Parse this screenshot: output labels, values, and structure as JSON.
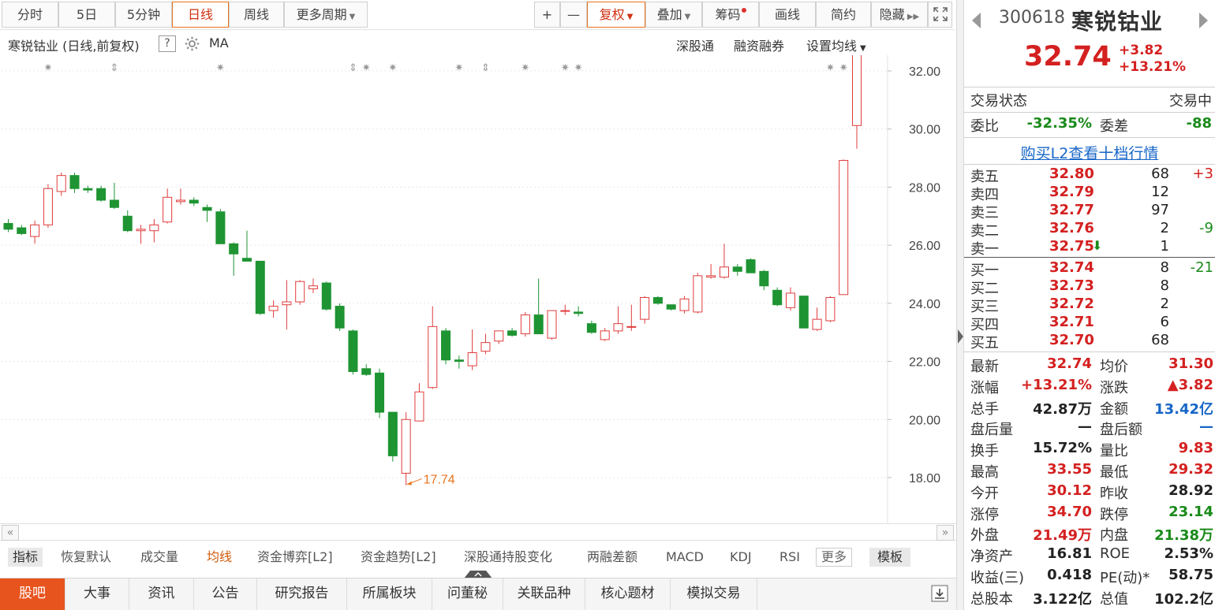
{
  "toolbar": {
    "left": [
      "分时",
      "5日",
      "5分钟",
      "日线",
      "周线",
      "更多周期"
    ],
    "right": [
      "+",
      "—",
      "复权",
      "叠加",
      "筹码",
      "画线",
      "简约",
      "隐藏"
    ]
  },
  "subheader": {
    "title": "寒锐钴业 (日线,前复权)",
    "help": "?",
    "ma": "MA",
    "links": [
      "深股通",
      "融资融券",
      "设置均线"
    ]
  },
  "chart_data": {
    "type": "candlestick",
    "y_ticks": [
      "32.00",
      "30.00",
      "28.00",
      "26.00",
      "24.00",
      "22.00",
      "20.00",
      "18.00"
    ],
    "ylim": [
      17.3,
      33.9
    ],
    "annotation_high": "33.55",
    "annotation_low": "17.74",
    "candles": [
      [
        26.75,
        26.9,
        26.45,
        26.55
      ],
      [
        26.6,
        26.7,
        26.35,
        26.4
      ],
      [
        26.3,
        26.85,
        26.05,
        26.7
      ],
      [
        26.7,
        28.1,
        26.6,
        27.95
      ],
      [
        27.85,
        28.5,
        27.7,
        28.4
      ],
      [
        28.4,
        28.5,
        27.8,
        27.95
      ],
      [
        27.95,
        28.05,
        27.8,
        27.9
      ],
      [
        27.95,
        28.05,
        27.5,
        27.55
      ],
      [
        27.55,
        28.15,
        27.25,
        27.3
      ],
      [
        27.0,
        27.2,
        26.45,
        26.5
      ],
      [
        26.5,
        26.7,
        26.05,
        26.55
      ],
      [
        26.5,
        26.9,
        26.1,
        26.7
      ],
      [
        26.8,
        27.95,
        26.75,
        27.65
      ],
      [
        27.5,
        27.95,
        27.4,
        27.55
      ],
      [
        27.55,
        27.65,
        27.35,
        27.45
      ],
      [
        27.3,
        27.4,
        26.8,
        27.2
      ],
      [
        27.15,
        27.25,
        26.1,
        26.05
      ],
      [
        26.05,
        26.1,
        24.95,
        25.7
      ],
      [
        25.55,
        26.5,
        25.45,
        25.45
      ],
      [
        25.45,
        25.45,
        23.6,
        23.65
      ],
      [
        23.75,
        24.1,
        23.5,
        23.9
      ],
      [
        23.95,
        24.8,
        23.1,
        24.05
      ],
      [
        24.05,
        24.8,
        23.95,
        24.75
      ],
      [
        24.5,
        24.85,
        24.35,
        24.6
      ],
      [
        24.7,
        24.75,
        23.75,
        23.8
      ],
      [
        23.9,
        24.0,
        23.05,
        23.15
      ],
      [
        23.05,
        23.1,
        21.55,
        21.65
      ],
      [
        21.75,
        21.9,
        21.5,
        21.55
      ],
      [
        21.6,
        21.75,
        20.05,
        20.25
      ],
      [
        20.25,
        20.25,
        18.55,
        18.75
      ],
      [
        18.15,
        20.25,
        17.74,
        20.0
      ],
      [
        19.95,
        21.25,
        19.95,
        20.95
      ],
      [
        21.1,
        23.9,
        21.05,
        23.2
      ],
      [
        23.05,
        23.15,
        21.9,
        22.05
      ],
      [
        22.05,
        22.2,
        21.75,
        22.0
      ],
      [
        21.85,
        23.1,
        21.7,
        22.3
      ],
      [
        22.35,
        22.95,
        22.25,
        22.65
      ],
      [
        22.7,
        23.05,
        22.6,
        23.05
      ],
      [
        23.05,
        23.15,
        22.85,
        22.9
      ],
      [
        22.95,
        23.7,
        22.85,
        23.6
      ],
      [
        23.6,
        24.85,
        23.1,
        22.95
      ],
      [
        22.8,
        23.75,
        22.75,
        23.75
      ],
      [
        23.75,
        23.95,
        23.6,
        23.75
      ],
      [
        23.7,
        23.9,
        23.55,
        23.65
      ],
      [
        23.3,
        23.4,
        22.95,
        23.0
      ],
      [
        22.75,
        23.15,
        22.7,
        23.05
      ],
      [
        23.05,
        23.9,
        22.95,
        23.3
      ],
      [
        23.2,
        23.95,
        23.05,
        23.2
      ],
      [
        23.45,
        24.25,
        23.3,
        24.2
      ],
      [
        24.2,
        24.25,
        23.95,
        24.0
      ],
      [
        23.95,
        23.95,
        23.75,
        23.8
      ],
      [
        23.75,
        24.25,
        23.65,
        24.15
      ],
      [
        23.7,
        25.05,
        23.65,
        24.95
      ],
      [
        24.9,
        25.35,
        24.85,
        24.95
      ],
      [
        24.9,
        26.05,
        24.85,
        25.25
      ],
      [
        25.25,
        25.35,
        24.95,
        25.1
      ],
      [
        25.5,
        25.55,
        25.15,
        25.05
      ],
      [
        25.1,
        25.15,
        24.45,
        24.6
      ],
      [
        24.45,
        24.55,
        23.9,
        23.95
      ],
      [
        23.85,
        24.55,
        23.75,
        24.35
      ],
      [
        24.25,
        24.25,
        23.15,
        23.15
      ],
      [
        23.1,
        23.85,
        23.05,
        23.45
      ],
      [
        23.4,
        24.25,
        23.35,
        24.2
      ],
      [
        24.3,
        28.95,
        24.3,
        28.92
      ],
      [
        30.12,
        33.55,
        29.32,
        32.74
      ]
    ],
    "top_markers": [
      {
        "i": 3,
        "m": "✷"
      },
      {
        "i": 8,
        "m": "⇕"
      },
      {
        "i": 16,
        "m": "✷"
      },
      {
        "i": 26,
        "m": "⇕"
      },
      {
        "i": 27,
        "m": "✷"
      },
      {
        "i": 29,
        "m": "✷"
      },
      {
        "i": 34,
        "m": "✷"
      },
      {
        "i": 36,
        "m": "⇕"
      },
      {
        "i": 39,
        "m": "✷"
      },
      {
        "i": 42,
        "m": "✷"
      },
      {
        "i": 43,
        "m": "✷"
      },
      {
        "i": 62,
        "m": "✷"
      },
      {
        "i": 63,
        "m": "✷"
      }
    ]
  },
  "indicators": [
    "指标",
    "恢复默认",
    "成交量",
    "均线",
    "资金博弈[L2]",
    "资金趋势[L2]",
    "深股通持股变化",
    "两融差额",
    "MACD",
    "KDJ",
    "RSI",
    "更多",
    "模板"
  ],
  "bottom_tabs": [
    "股吧",
    "大事",
    "资讯",
    "公告",
    "研究报告",
    "所属板块",
    "问董秘",
    "关联品种",
    "核心题材",
    "模拟交易"
  ],
  "stock": {
    "code": "300618",
    "name": "寒锐钴业",
    "price": "32.74",
    "change": "+3.82",
    "change_pct": "+13.21%"
  },
  "status": {
    "label": "交易状态",
    "value": "交易中"
  },
  "weibi": {
    "label": "委比",
    "value": "-32.35%",
    "diff_label": "委差",
    "diff_value": "-88"
  },
  "l2_link": "购买L2查看十档行情",
  "asks": [
    {
      "label": "卖五",
      "price": "32.80",
      "vol": "68",
      "chg": "+3"
    },
    {
      "label": "卖四",
      "price": "32.79",
      "vol": "12",
      "chg": ""
    },
    {
      "label": "卖三",
      "price": "32.77",
      "vol": "97",
      "chg": ""
    },
    {
      "label": "卖二",
      "price": "32.76",
      "vol": "2",
      "chg": "-9"
    },
    {
      "label": "卖一",
      "price": "32.75",
      "vol": "1",
      "chg": ""
    }
  ],
  "bids": [
    {
      "label": "买一",
      "price": "32.74",
      "vol": "8",
      "chg": "-21"
    },
    {
      "label": "买二",
      "price": "32.73",
      "vol": "8",
      "chg": ""
    },
    {
      "label": "买三",
      "price": "32.72",
      "vol": "2",
      "chg": ""
    },
    {
      "label": "买四",
      "price": "32.71",
      "vol": "6",
      "chg": ""
    },
    {
      "label": "买五",
      "price": "32.70",
      "vol": "68",
      "chg": ""
    }
  ],
  "stats": [
    {
      "l1": "最新",
      "v1": "32.74",
      "c1": "red",
      "l2": "均价",
      "v2": "31.30",
      "c2": "red"
    },
    {
      "l1": "涨幅",
      "v1": "+13.21%",
      "c1": "red",
      "l2": "涨跌",
      "v2": "▲3.82",
      "c2": "red"
    },
    {
      "l1": "总手",
      "v1": "42.87万",
      "c1": "dark",
      "l2": "金额",
      "v2": "13.42亿",
      "c2": "blue"
    },
    {
      "l1": "盘后量",
      "v1": "—",
      "c1": "dark",
      "l2": "盘后额",
      "v2": "—",
      "c2": "blue"
    },
    {
      "l1": "换手",
      "v1": "15.72%",
      "c1": "dark",
      "l2": "量比",
      "v2": "9.83",
      "c2": "red"
    },
    {
      "l1": "最高",
      "v1": "33.55",
      "c1": "red",
      "l2": "最低",
      "v2": "29.32",
      "c2": "red"
    },
    {
      "l1": "今开",
      "v1": "30.12",
      "c1": "red",
      "l2": "昨收",
      "v2": "28.92",
      "c2": "dark"
    },
    {
      "l1": "涨停",
      "v1": "34.70",
      "c1": "red",
      "l2": "跌停",
      "v2": "23.14",
      "c2": "green"
    },
    {
      "l1": "外盘",
      "v1": "21.49万",
      "c1": "red",
      "l2": "内盘",
      "v2": "21.38万",
      "c2": "green"
    },
    {
      "l1": "净资产",
      "v1": "16.81",
      "c1": "dark",
      "l2": "ROE",
      "v2": "2.53%",
      "c2": "dark"
    },
    {
      "l1": "收益(三)",
      "v1": "0.418",
      "c1": "dark",
      "l2": "PE(动)*",
      "v2": "58.75",
      "c2": "dark"
    },
    {
      "l1": "总股本",
      "v1": "3.122亿",
      "c1": "dark",
      "l2": "总值",
      "v2": "102.2亿",
      "c2": "dark"
    }
  ],
  "colors": {
    "up": "#e03c3c",
    "down": "#1e9432",
    "accent": "#e8731f"
  }
}
